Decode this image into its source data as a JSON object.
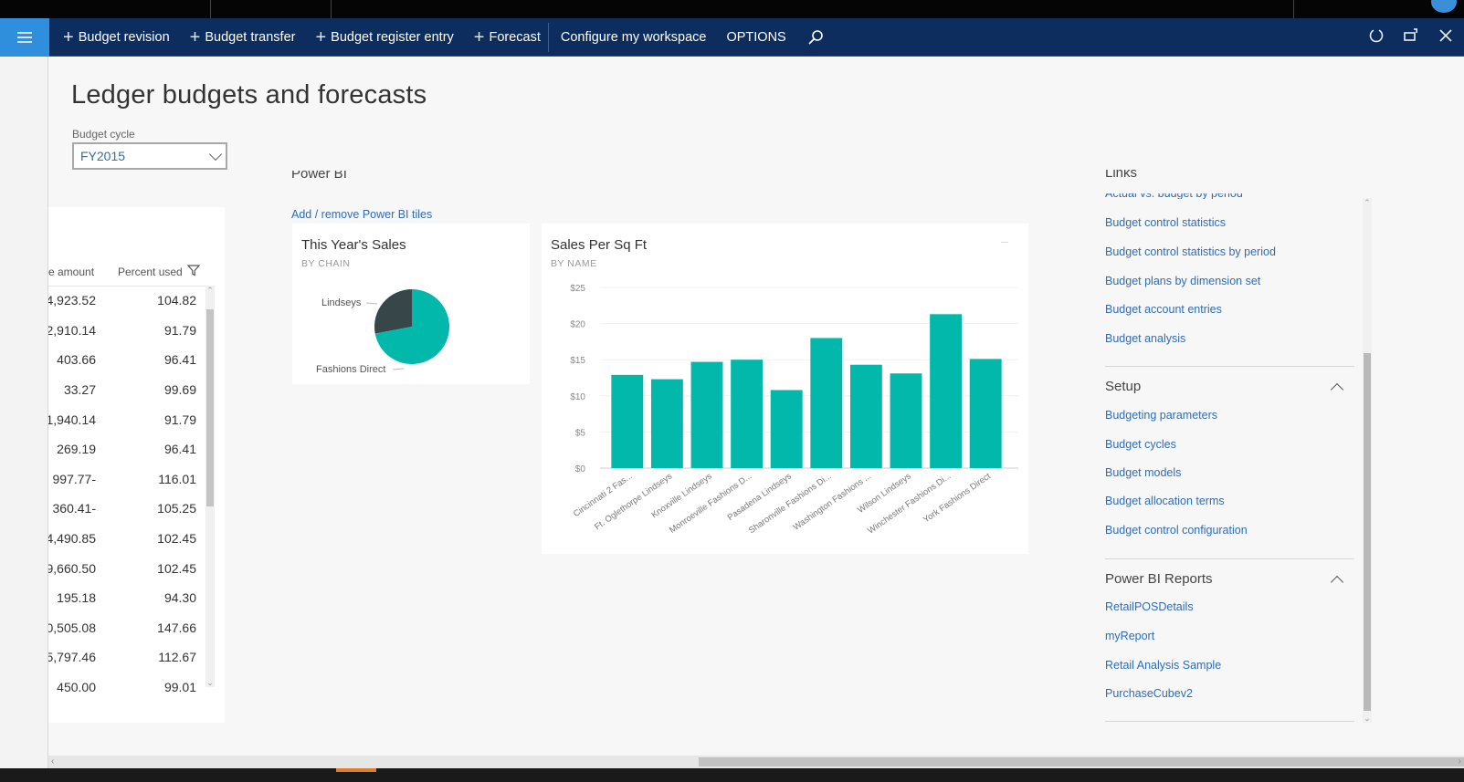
{
  "appbar": {
    "actions": [
      {
        "label": "Budget revision",
        "icon": "plus-icon"
      },
      {
        "label": "Budget transfer",
        "icon": "plus-icon"
      },
      {
        "label": "Budget register entry",
        "icon": "plus-icon"
      },
      {
        "label": "Forecast",
        "icon": "plus-icon"
      }
    ],
    "configure_label": "Configure my workspace",
    "options_label": "OPTIONS",
    "search_icon": "search-icon",
    "right_icons": [
      "refresh-icon",
      "open-new-window-icon",
      "close-icon"
    ]
  },
  "page": {
    "title": "Ledger budgets and forecasts",
    "budget_cycle_label": "Budget cycle",
    "budget_cycle_value": "FY2015"
  },
  "table": {
    "columns": [
      "e amount",
      "Percent used"
    ],
    "rows": [
      [
        "4,923.52",
        "104.82"
      ],
      [
        "2,910.14",
        "91.79"
      ],
      [
        "403.66",
        "96.41"
      ],
      [
        "33.27",
        "99.69"
      ],
      [
        "1,940.14",
        "91.79"
      ],
      [
        "269.19",
        "96.41"
      ],
      [
        "-997.77",
        "116.01"
      ],
      [
        "-360.41",
        "105.25"
      ],
      [
        "4,490.85",
        "102.45"
      ],
      [
        "9,660.50",
        "102.45"
      ],
      [
        "195.18",
        "94.30"
      ],
      [
        "0,505.08",
        "147.66"
      ],
      [
        "5,797.46",
        "112.67"
      ],
      [
        "450.00",
        "99.01"
      ]
    ]
  },
  "powerbi": {
    "heading": "Power BI",
    "add_remove_label": "Add / remove Power BI tiles"
  },
  "chart_data": [
    {
      "type": "pie",
      "title": "This Year's Sales",
      "subtitle": "BY CHAIN",
      "categories": [
        "Lindseys",
        "Fashions Direct"
      ],
      "values": [
        28,
        72
      ],
      "colors": [
        "#374649",
        "#01b8aa"
      ]
    },
    {
      "type": "bar",
      "title": "Sales Per Sq Ft",
      "subtitle": "BY NAME",
      "categories": [
        "Cincinnati 2 Fas...",
        "Ft. Oglethorpe Lindseys",
        "Knoxville Lindseys",
        "Monroeville Fashions D...",
        "Pasadena Lindseys",
        "Sharonville Fashions Di...",
        "Washington Fashions ...",
        "Wilson Lindseys",
        "Winchester Fashions Di...",
        "York Fashions Direct"
      ],
      "values": [
        12.9,
        12.3,
        14.7,
        15.0,
        10.8,
        18.0,
        14.3,
        13.1,
        21.3,
        15.1
      ],
      "yticks": [
        "$0",
        "$5",
        "$10",
        "$15",
        "$20",
        "$25"
      ],
      "ylim": [
        0,
        25
      ],
      "grid": true,
      "color": "#01b8aa"
    }
  ],
  "links": {
    "heading": "Links",
    "partial_item": "Actual vs. budget by period",
    "items": [
      "Budget control statistics",
      "Budget control statistics by period",
      "Budget plans by dimension set",
      "Budget account entries",
      "Budget analysis"
    ],
    "setup": {
      "title": "Setup",
      "items": [
        "Budgeting parameters",
        "Budget cycles",
        "Budget models",
        "Budget allocation terms",
        "Budget control configuration"
      ]
    },
    "reports": {
      "title": "Power BI Reports",
      "items": [
        "RetailPOSDetails",
        "myReport",
        "Retail Analysis Sample",
        "PurchaseCubev2"
      ]
    }
  }
}
